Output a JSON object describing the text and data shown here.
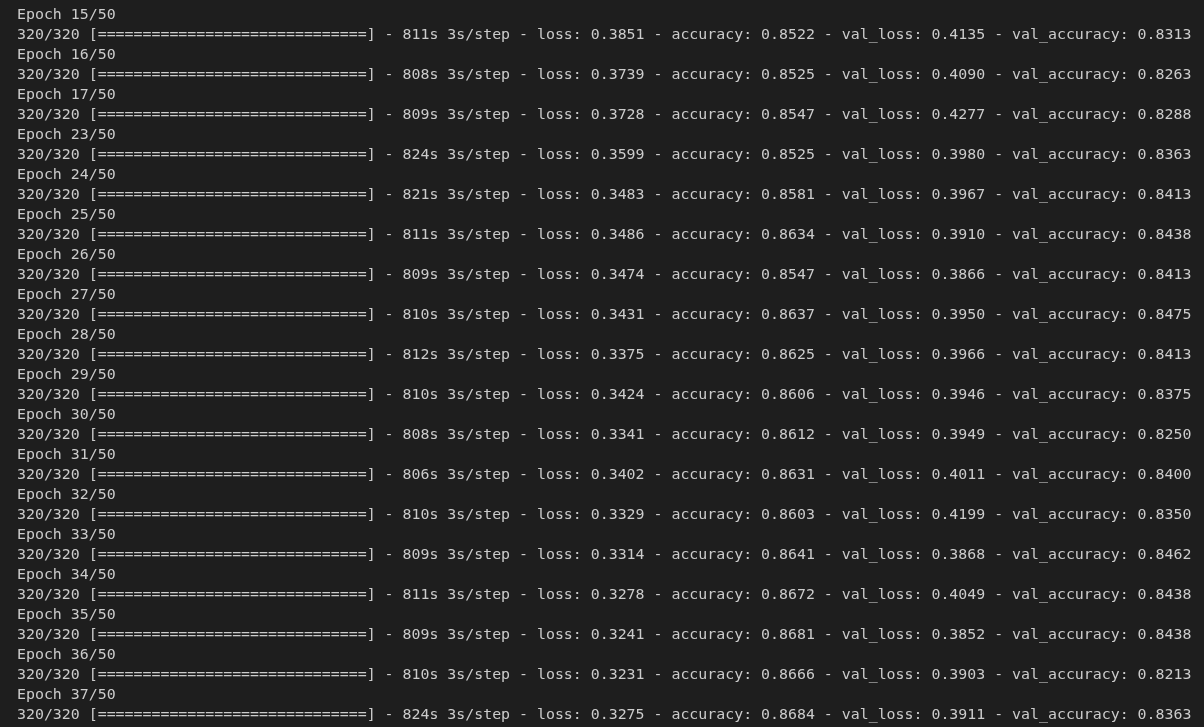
{
  "terminal": {
    "lines": [
      "Epoch 15/50",
      "320/320 [==============================] - 811s 3s/step - loss: 0.3851 - accuracy: 0.8522 - val_loss: 0.4135 - val_accuracy: 0.8313",
      "Epoch 16/50",
      "320/320 [==============================] - 808s 3s/step - loss: 0.3739 - accuracy: 0.8525 - val_loss: 0.4090 - val_accuracy: 0.8263",
      "Epoch 17/50",
      "320/320 [==============================] - 809s 3s/step - loss: 0.3728 - accuracy: 0.8547 - val_loss: 0.4277 - val_accuracy: 0.8288",
      "Epoch 23/50",
      "320/320 [==============================] - 824s 3s/step - loss: 0.3599 - accuracy: 0.8525 - val_loss: 0.3980 - val_accuracy: 0.8363",
      "Epoch 24/50",
      "320/320 [==============================] - 821s 3s/step - loss: 0.3483 - accuracy: 0.8581 - val_loss: 0.3967 - val_accuracy: 0.8413",
      "Epoch 25/50",
      "320/320 [==============================] - 811s 3s/step - loss: 0.3486 - accuracy: 0.8634 - val_loss: 0.3910 - val_accuracy: 0.8438",
      "Epoch 26/50",
      "320/320 [==============================] - 809s 3s/step - loss: 0.3474 - accuracy: 0.8547 - val_loss: 0.3866 - val_accuracy: 0.8413",
      "Epoch 27/50",
      "320/320 [==============================] - 810s 3s/step - loss: 0.3431 - accuracy: 0.8637 - val_loss: 0.3950 - val_accuracy: 0.8475",
      "Epoch 28/50",
      "320/320 [==============================] - 812s 3s/step - loss: 0.3375 - accuracy: 0.8625 - val_loss: 0.3966 - val_accuracy: 0.8413",
      "Epoch 29/50",
      "320/320 [==============================] - 810s 3s/step - loss: 0.3424 - accuracy: 0.8606 - val_loss: 0.3946 - val_accuracy: 0.8375",
      "Epoch 30/50",
      "320/320 [==============================] - 808s 3s/step - loss: 0.3341 - accuracy: 0.8612 - val_loss: 0.3949 - val_accuracy: 0.8250",
      "Epoch 31/50",
      "320/320 [==============================] - 806s 3s/step - loss: 0.3402 - accuracy: 0.8631 - val_loss: 0.4011 - val_accuracy: 0.8400",
      "Epoch 32/50",
      "320/320 [==============================] - 810s 3s/step - loss: 0.3329 - accuracy: 0.8603 - val_loss: 0.4199 - val_accuracy: 0.8350",
      "Epoch 33/50",
      "320/320 [==============================] - 809s 3s/step - loss: 0.3314 - accuracy: 0.8641 - val_loss: 0.3868 - val_accuracy: 0.8462",
      "Epoch 34/50",
      "320/320 [==============================] - 811s 3s/step - loss: 0.3278 - accuracy: 0.8672 - val_loss: 0.4049 - val_accuracy: 0.8438",
      "Epoch 35/50",
      "320/320 [==============================] - 809s 3s/step - loss: 0.3241 - accuracy: 0.8681 - val_loss: 0.3852 - val_accuracy: 0.8438",
      "Epoch 36/50",
      "320/320 [==============================] - 810s 3s/step - loss: 0.3231 - accuracy: 0.8666 - val_loss: 0.3903 - val_accuracy: 0.8213",
      "Epoch 37/50",
      "320/320 [==============================] - 824s 3s/step - loss: 0.3275 - accuracy: 0.8684 - val_loss: 0.3911 - val_accuracy: 0.8363"
    ]
  }
}
